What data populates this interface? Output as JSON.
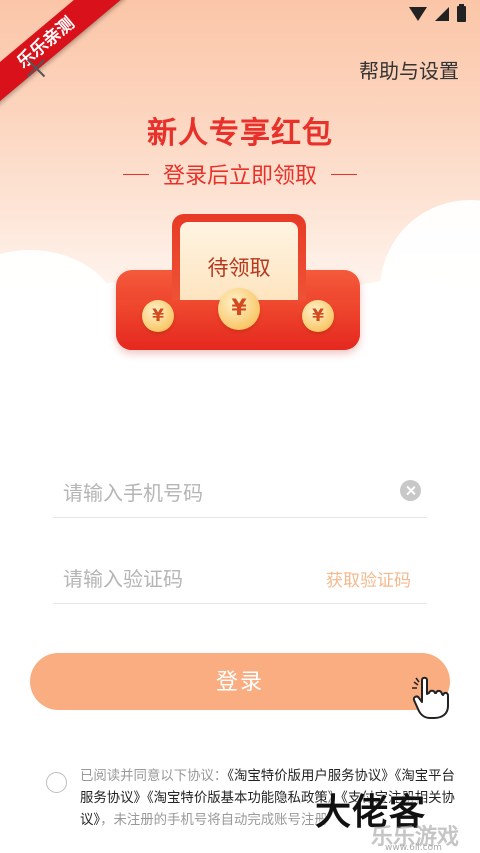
{
  "header": {
    "banner": "乐乐亲测",
    "help_link": "帮助与设置"
  },
  "promo": {
    "title": "新人专享红包",
    "subtitle": "登录后立即领取",
    "redpack_label": "待领取",
    "coin_symbol": "¥"
  },
  "form": {
    "phone_placeholder": "请输入手机号码",
    "code_placeholder": "请输入验证码",
    "get_code": "获取验证码",
    "login": "登录"
  },
  "agreement": {
    "prefix": "已阅读并同意以下协议：",
    "p1": "《淘宝特价版用户服务协议》",
    "p2": "《淘宝平台服务协议》",
    "p3": "《淘宝特价版基本功能隐私政策》",
    "p4": "《支付宝注册相关协议》",
    "suffix": "，未注册的手机号将自动完成账号注册"
  },
  "watermark": {
    "brand": "大佬客",
    "sub": "乐乐游戏",
    "url": "www.6ll.com"
  },
  "colors": {
    "accent": "#e8312a",
    "button": "#f9ad80",
    "get_code": "#f5b98d"
  }
}
